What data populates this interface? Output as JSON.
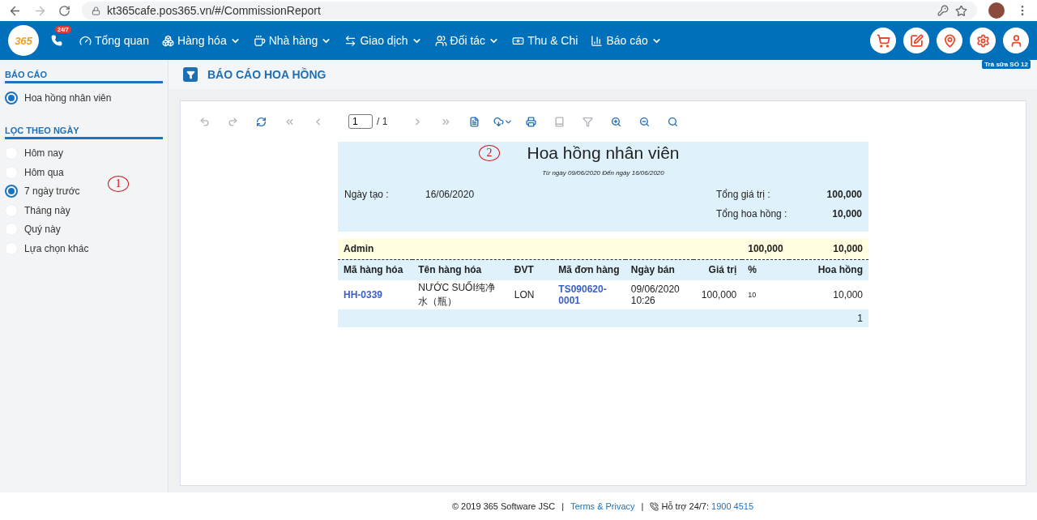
{
  "browser": {
    "url": "kt365cafe.pos365.vn/#/CommissionReport"
  },
  "navbar": {
    "logo": "365",
    "hotline_badge": "24/7",
    "items": [
      {
        "kind": "dashboard",
        "label": "Tổng quan",
        "has_menu": false
      },
      {
        "kind": "boxes",
        "label": "Hàng hóa",
        "has_menu": true
      },
      {
        "kind": "coffee",
        "label": "Nhà hàng",
        "has_menu": true
      },
      {
        "kind": "transfer",
        "label": "Giao dịch",
        "has_menu": true
      },
      {
        "kind": "users",
        "label": "Đối tác",
        "has_menu": true
      },
      {
        "kind": "money",
        "label": "Thu & Chi",
        "has_menu": false
      },
      {
        "kind": "chart",
        "label": "Báo cáo",
        "has_menu": true
      }
    ],
    "actions": [
      {
        "kind": "cart"
      },
      {
        "kind": "edit"
      },
      {
        "kind": "pin"
      },
      {
        "kind": "gear"
      },
      {
        "kind": "user"
      }
    ],
    "store": "Trà sữa SỐ 12"
  },
  "sidebar": {
    "sections": [
      {
        "title": "BÁO CÁO",
        "options": [
          {
            "label": "Hoa hồng nhân viên",
            "selected": true
          }
        ]
      },
      {
        "title": "LỌC THEO NGÀY",
        "options": [
          {
            "label": "Hôm nay",
            "selected": false
          },
          {
            "label": "Hôm qua",
            "selected": false
          },
          {
            "label": "7 ngày trước",
            "selected": true
          },
          {
            "label": "Tháng này",
            "selected": false
          },
          {
            "label": "Quý này",
            "selected": false
          },
          {
            "label": "Lựa chọn khác",
            "selected": false
          }
        ]
      }
    ]
  },
  "page_title": "BÁO CÁO HOA HỒNG",
  "viewer": {
    "toolbar": [
      {
        "kind": "undo",
        "disabled": true
      },
      {
        "kind": "redo",
        "disabled": true
      },
      {
        "kind": "refresh",
        "disabled": false
      },
      {
        "kind": "first",
        "disabled": true
      },
      {
        "kind": "prev",
        "disabled": true
      },
      {
        "kind": "page"
      },
      {
        "kind": "next",
        "disabled": true
      },
      {
        "kind": "last",
        "disabled": true
      },
      {
        "kind": "document",
        "disabled": false
      },
      {
        "kind": "download",
        "disabled": false
      },
      {
        "kind": "print",
        "disabled": false
      },
      {
        "kind": "book",
        "disabled": true
      },
      {
        "kind": "filter",
        "disabled": true
      },
      {
        "kind": "zoom-in",
        "disabled": false
      },
      {
        "kind": "zoom-out",
        "disabled": false
      },
      {
        "kind": "search",
        "disabled": false
      }
    ],
    "page": "1",
    "page_total": "/ 1"
  },
  "report": {
    "title": "Hoa hồng nhân viên",
    "subtitle": "Từ ngày 09/06/2020 Đến ngày 16/06/2020",
    "created_label": "Ngày tạo :",
    "created_value": "16/06/2020",
    "totals": [
      {
        "label": "Tổng giá trị :",
        "value": "100,000"
      },
      {
        "label": "Tổng hoa hồng :",
        "value": "10,000"
      }
    ],
    "group": {
      "name": "Admin",
      "value": "100,000",
      "commission": "10,000"
    },
    "columns": [
      "Mã hàng hóa",
      "Tên hàng hóa",
      "ĐVT",
      "Mã đơn hàng",
      "Ngày bán",
      "Giá trị",
      "%",
      "Hoa hồng"
    ],
    "rows": [
      [
        {
          "text": "HH-0339",
          "kind": "link"
        },
        {
          "text": "NƯỚC SUỐI纯净水（瓶）",
          "kind": "text"
        },
        {
          "text": "LON",
          "kind": "text"
        },
        {
          "text": "TS090620-0001",
          "kind": "link"
        },
        {
          "text": "09/06/2020 10:26",
          "kind": "text"
        },
        {
          "text": "100,000",
          "kind": "text"
        },
        {
          "text": "10",
          "kind": "small"
        },
        {
          "text": "10,000",
          "kind": "text"
        }
      ]
    ],
    "footer_count": "1"
  },
  "annotations": [
    {
      "text": "1"
    },
    {
      "text": "2"
    }
  ],
  "footer": {
    "copyright": "© 2019 365 Software JSC",
    "separator": "|",
    "link": "Terms & Privacy",
    "separator_2": "|",
    "support_label": "Hỗ trợ 24/7:",
    "support_phone": "1900 4515"
  }
}
